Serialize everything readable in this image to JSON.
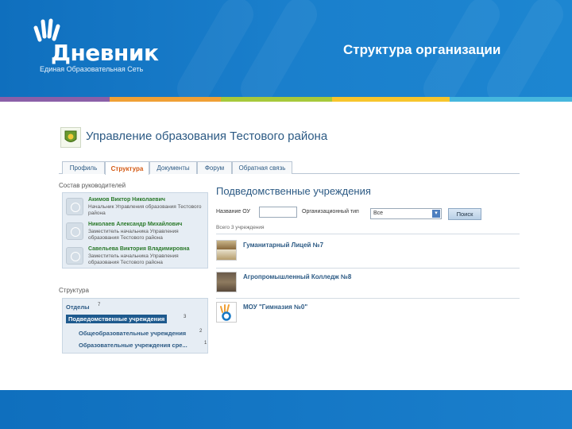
{
  "slide": {
    "title": "Структура организации",
    "logo_word": "Дневник",
    "logo_subtitle": "Единая Образовательная Сеть",
    "stripe_colors": [
      "#8b5fa8",
      "#f0a035",
      "#a7c93b",
      "#f7c52c",
      "#46b7dd"
    ]
  },
  "org": {
    "title": "Управление образования Тестового района"
  },
  "tabs": [
    {
      "label": "Профиль",
      "active": false
    },
    {
      "label": "Структура",
      "active": true
    },
    {
      "label": "Документы",
      "active": false
    },
    {
      "label": "Форум",
      "active": false
    },
    {
      "label": "Обратная связь",
      "active": false
    }
  ],
  "leadership": {
    "heading": "Состав руководителей",
    "people": [
      {
        "name": "Акимов Виктор Николаевич",
        "position": "Начальник Управления образования Тестового района"
      },
      {
        "name": "Николаев Александр Михайлович",
        "position": "Заместитель начальника Управления образования Тестового района"
      },
      {
        "name": "Савельева Виктория Владимировна",
        "position": "Заместитель начальника Управления образования Тестового района"
      }
    ]
  },
  "structure": {
    "heading": "Структура",
    "items": [
      {
        "label": "Отделы",
        "count": "7"
      },
      {
        "label": "Подведомственные учреждения",
        "count": "3"
      },
      {
        "label": "Общеобразовательные учреждения",
        "count": "2"
      },
      {
        "label": "Образовательные учреждения сре...",
        "count": "1"
      }
    ]
  },
  "main": {
    "heading": "Подведомственные учреждения",
    "filter": {
      "name_label": "Название ОУ",
      "name_value": "",
      "type_label": "Организационный тип",
      "type_value": "Все",
      "search_button": "Поиск"
    },
    "found_text": "Всего 3 учреждения",
    "institutions": [
      {
        "name": "Гуманитарный Лицей №7"
      },
      {
        "name": "Агропромышленный Колледж №8"
      },
      {
        "name": "МОУ \"Гимназия №0\""
      }
    ]
  },
  "colors": {
    "header_blue": "#1778c4",
    "link_blue": "#2c5a84",
    "active_tab": "#d45a14",
    "person_name": "#2c7a2c",
    "selected_item": "#1e5a8e"
  },
  "icons": {
    "logo": "hand-logo-icon",
    "org": "org-emblem-icon",
    "person": "default-avatar-icon"
  }
}
